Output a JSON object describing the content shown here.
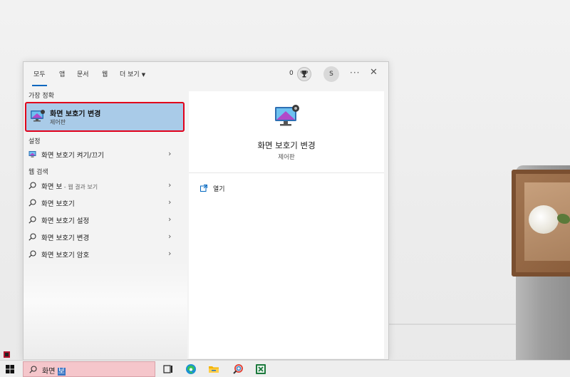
{
  "start_menu": {
    "tabs": [
      {
        "label": "모두",
        "active": true
      },
      {
        "label": "앱"
      },
      {
        "label": "문서"
      },
      {
        "label": "웹"
      },
      {
        "label": "더 보기"
      }
    ],
    "header": {
      "count": "0",
      "rewards_icon": "trophy-icon",
      "avatar_initial": "S",
      "more_label": "···",
      "close_label": "✕"
    },
    "best_match": {
      "section_label": "가장 정확",
      "title": "화면 보호기 변경",
      "subtitle": "제어판",
      "icon": "monitor-settings-icon"
    },
    "settings": {
      "section_label": "설정",
      "items": [
        {
          "label": "화면 보호기 켜기/끄기",
          "icon": "display-icon"
        }
      ]
    },
    "web_search": {
      "section_label": "웹 검색",
      "items": [
        {
          "label": "화면 보",
          "sub": " - 웹 결과 보기"
        },
        {
          "label": "화면 보호기",
          "sub": ""
        },
        {
          "label": "화면 보호기 설정",
          "sub": ""
        },
        {
          "label": "화면 보호기 변경",
          "sub": ""
        },
        {
          "label": "화면 보호기 암호",
          "sub": ""
        }
      ]
    },
    "detail": {
      "title": "화면 보호기 변경",
      "subtitle": "제어판",
      "actions": [
        {
          "label": "열기",
          "icon": "open-icon"
        }
      ]
    }
  },
  "taskbar": {
    "search_typed": "화면 ",
    "search_selected": "보",
    "icons": [
      "start-icon",
      "task-view-icon",
      "edge-icon",
      "file-explorer-icon",
      "search-app-icon",
      "excel-icon"
    ]
  },
  "colors": {
    "accent": "#0067c0",
    "best_match_bg": "#a9cbe8",
    "highlight_border": "#e0001b",
    "search_box_bg": "#f5c6cb"
  }
}
